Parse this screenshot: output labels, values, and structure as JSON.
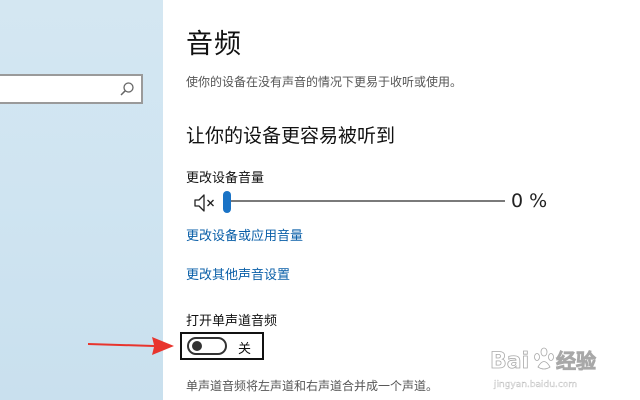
{
  "page": {
    "title": "音频",
    "description": "使你的设备在没有声音的情况下更易于收听或使用。"
  },
  "section": {
    "heading": "让你的设备更容易被听到"
  },
  "volume": {
    "label": "更改设备音量",
    "value_text": "0 %",
    "level_fraction": 0,
    "icon": "speaker-muted-icon",
    "accent_color": "#1a73c6"
  },
  "links": {
    "app_volume": "更改设备或应用音量",
    "other_sound": "更改其他声音设置"
  },
  "mono": {
    "label": "打开单声道音频",
    "state": "关",
    "on": false,
    "description": "单声道音频将左声道和右声道合并成一个声道。"
  },
  "search": {
    "icon": "search-icon",
    "placeholder": ""
  },
  "annotation": {
    "arrow_color": "#e8352e"
  },
  "watermark": {
    "text": "Bai du 经验",
    "subtext": "jingyan.baidu.com"
  }
}
